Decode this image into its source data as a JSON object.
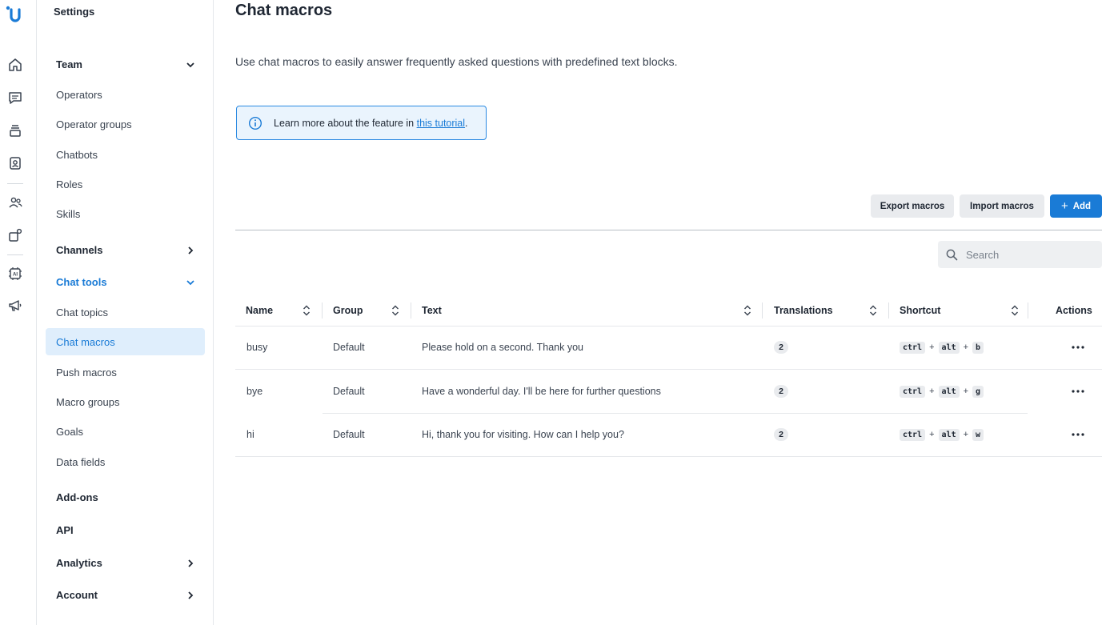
{
  "sidebar": {
    "title": "Settings",
    "sections": {
      "team": "Team",
      "channels": "Channels",
      "chat_tools": "Chat tools",
      "addons": "Add-ons",
      "api": "API",
      "analytics": "Analytics",
      "account": "Account"
    },
    "team_items": [
      "Operators",
      "Operator groups",
      "Chatbots",
      "Roles",
      "Skills"
    ],
    "chat_tools_items": [
      "Chat topics",
      "Chat macros",
      "Push macros",
      "Macro groups",
      "Goals",
      "Data fields"
    ],
    "active_item": "Chat macros"
  },
  "rail": {
    "icons": [
      "logo-icon",
      "home-icon",
      "chat-icon",
      "inbox-stack-icon",
      "contacts-icon",
      "team-icon",
      "integrations-icon",
      "ai-icon",
      "megaphone-icon"
    ]
  },
  "main": {
    "title": "Chat macros",
    "description": "Use chat macros to easily answer frequently asked questions with predefined text blocks.",
    "info": {
      "prefix": "Learn more about the feature in ",
      "link": "this tutorial",
      "suffix": "."
    },
    "buttons": {
      "export": "Export macros",
      "import": "Import macros",
      "add": "Add"
    },
    "search": {
      "placeholder": "Search"
    }
  },
  "table": {
    "columns": {
      "name": "Name",
      "group": "Group",
      "text": "Text",
      "translations": "Translations",
      "shortcut": "Shortcut",
      "actions": "Actions"
    },
    "rows": [
      {
        "name": "busy",
        "group": "Default",
        "text": "Please hold on a second. Thank you",
        "translations": "2",
        "keys": [
          "ctrl",
          "alt",
          "b"
        ]
      },
      {
        "name": "bye",
        "group": "Default",
        "text": "Have a wonderful day. I'll be here for further questions",
        "translations": "2",
        "keys": [
          "ctrl",
          "alt",
          "g"
        ]
      },
      {
        "name": "hi",
        "group": "Default",
        "text": "Hi, thank you for visiting. How can I help you?",
        "translations": "2",
        "keys": [
          "ctrl",
          "alt",
          "w"
        ]
      }
    ]
  },
  "colors": {
    "accent": "#1a7bd6",
    "active_bg": "#dfeefc",
    "info_bg": "#eaf4fd"
  }
}
